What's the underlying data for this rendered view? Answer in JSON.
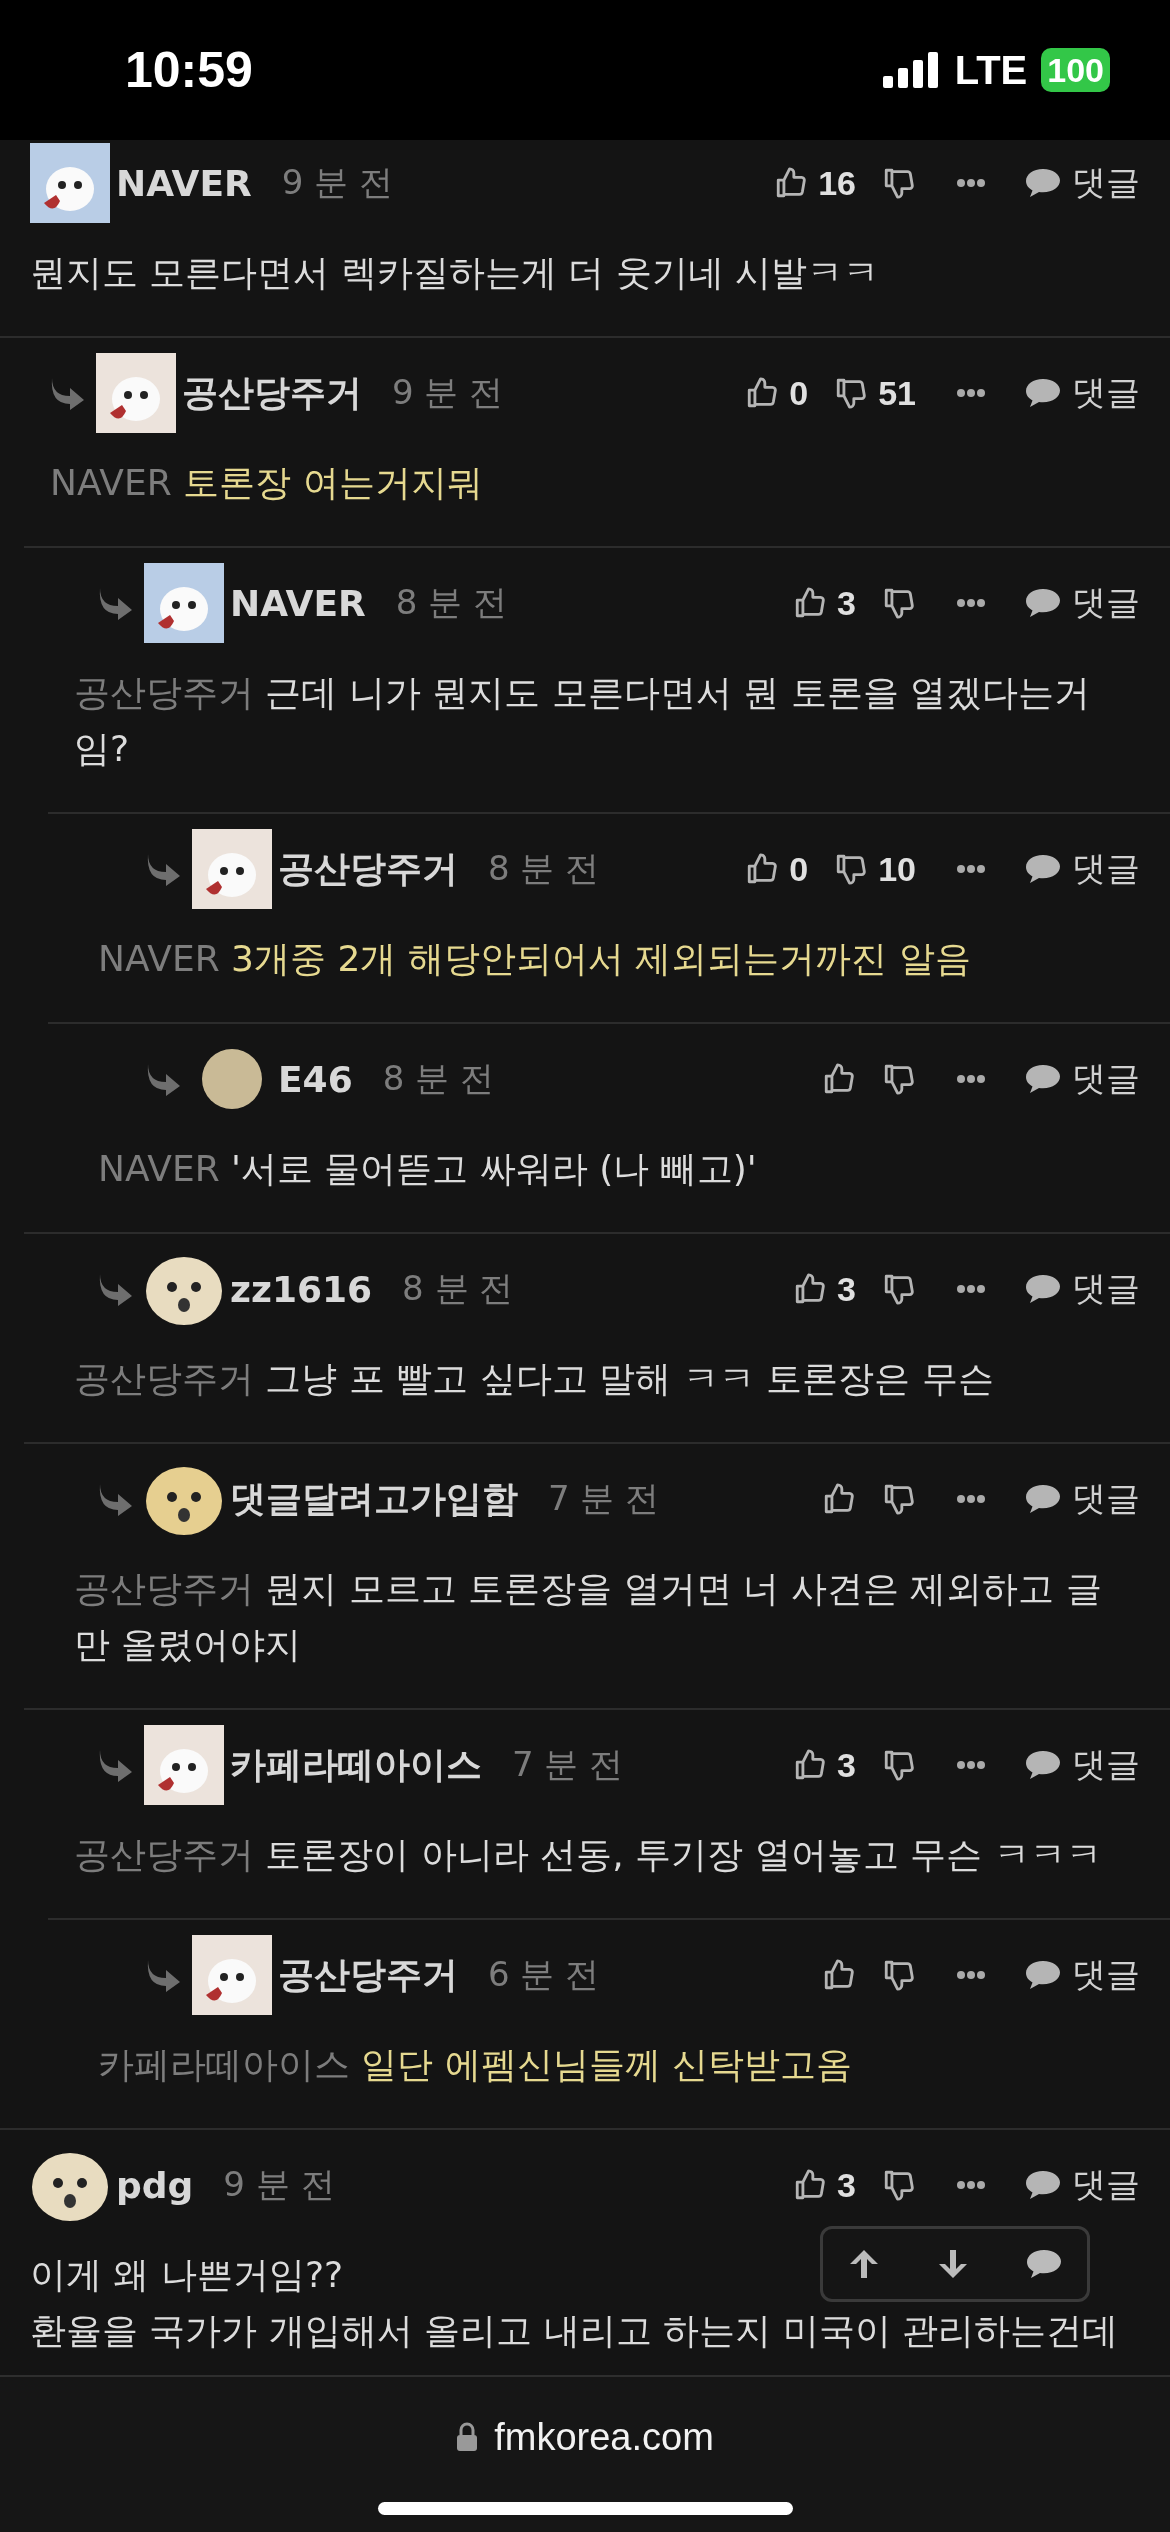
{
  "status_bar": {
    "time": "10:59",
    "network": "LTE",
    "battery": "100"
  },
  "comments": [
    {
      "author": "NAVER",
      "time": "9 분 전",
      "likes": "16",
      "reply_label": "댓글",
      "text": "뭔지도 모른다면서 렉카질하는게 더 웃기네 시발ㅋㅋ",
      "highlight": false,
      "avatar": {
        "kind": "square",
        "color": "#b9cde6"
      },
      "children": [
        {
          "author": "공산당주거",
          "time": "9 분 전",
          "likes": "0",
          "dislikes": "51",
          "reply_label": "댓글",
          "mention": "NAVER",
          "text": "토론장 여는거지뭐",
          "highlight": true,
          "avatar": {
            "kind": "square",
            "color": "#ece3dc"
          },
          "children": [
            {
              "author": "NAVER",
              "time": "8 분 전",
              "likes": "3",
              "reply_label": "댓글",
              "mention": "공산당주거",
              "text": "근데 니가 뭔지도 모른다면서 뭔 토론을 열겠다는거임?",
              "highlight": false,
              "avatar": {
                "kind": "square",
                "color": "#b9cde6"
              },
              "children": [
                {
                  "author": "공산당주거",
                  "time": "8 분 전",
                  "likes": "0",
                  "dislikes": "10",
                  "reply_label": "댓글",
                  "mention": "NAVER",
                  "text": "3개중 2개 해당안되어서 제외되는거까진 알음",
                  "highlight": true,
                  "avatar": {
                    "kind": "square",
                    "color": "#ece3dc"
                  }
                },
                {
                  "author": "E46",
                  "time": "8 분 전",
                  "reply_label": "댓글",
                  "mention": "NAVER",
                  "text": "'서로 물어뜯고 싸워라 (나 빼고)'",
                  "highlight": false,
                  "avatar": {
                    "kind": "dot",
                    "color": "#c9ba96"
                  }
                }
              ]
            },
            {
              "author": "zz1616",
              "time": "8 분 전",
              "likes": "3",
              "reply_label": "댓글",
              "mention": "공산당주거",
              "text": "그냥 포 빨고 싶다고 말해 ㅋㅋ 토론장은 무슨",
              "highlight": false,
              "avatar": {
                "kind": "round",
                "color": "#e8dcc0"
              }
            },
            {
              "author": "댓글달려고가입함",
              "time": "7 분 전",
              "reply_label": "댓글",
              "mention": "공산당주거",
              "text": "뭔지 모르고 토론장을 열거면 너 사견은 제외하고 글만 올렸어야지",
              "highlight": false,
              "avatar": {
                "kind": "round",
                "color": "#e6cf90"
              }
            },
            {
              "author": "카페라떼아이스",
              "time": "7 분 전",
              "likes": "3",
              "reply_label": "댓글",
              "mention": "공산당주거",
              "text": "토론장이 아니라 선동, 투기장 열어놓고 무슨 ㅋㅋㅋ",
              "highlight": false,
              "avatar": {
                "kind": "square",
                "color": "#ece3dc"
              },
              "children": [
                {
                  "author": "공산당주거",
                  "time": "6 분 전",
                  "reply_label": "댓글",
                  "mention": "카페라떼아이스",
                  "text": "일단 에펨신님들께 신탁받고옴",
                  "highlight": true,
                  "avatar": {
                    "kind": "square",
                    "color": "#ece3dc"
                  }
                }
              ]
            }
          ]
        }
      ]
    },
    {
      "author": "pdg",
      "time": "9 분 전",
      "likes": "3",
      "reply_label": "댓글",
      "lines": [
        "이게 왜 나쁜거임??",
        "환율을 국가가 개입해서 올리고 내리고 하는지 미국이 관리하는건데"
      ],
      "highlight": false,
      "avatar": {
        "kind": "round",
        "color": "#e8dcc0"
      }
    }
  ],
  "browser_bar": {
    "url": "fmkorea.com"
  }
}
